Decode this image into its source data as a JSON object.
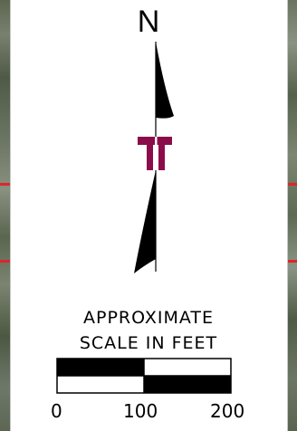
{
  "north_arrow": {
    "letter": "N",
    "logo_color": "#8b0c4a"
  },
  "scale_bar": {
    "title_line1": "APPROXIMATE",
    "title_line2": "SCALE IN FEET",
    "ticks": [
      "0",
      "100",
      "200"
    ]
  },
  "colors": {
    "property_line": "#e0242a",
    "panel": "#ffffff"
  }
}
